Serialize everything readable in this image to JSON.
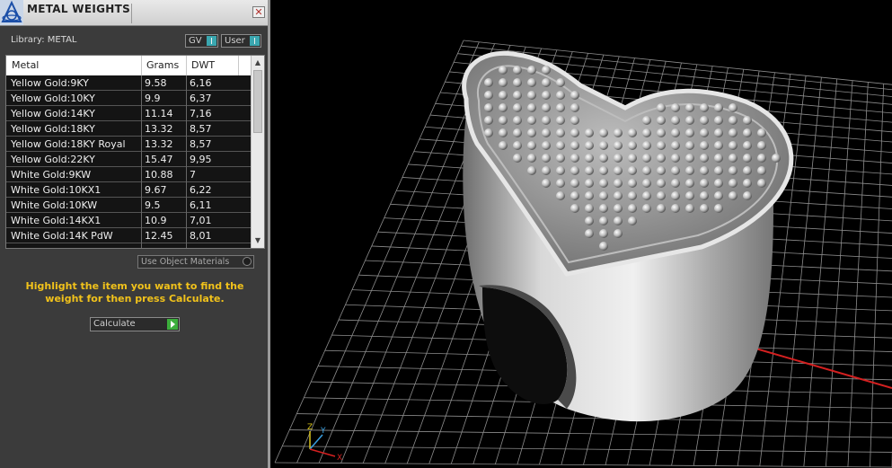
{
  "panel": {
    "title": "METAL WEIGHTS",
    "close_glyph": "✕",
    "library_label": "Library: METAL",
    "toggles": [
      {
        "label": "GV"
      },
      {
        "label": "User"
      }
    ],
    "columns": [
      "Metal",
      "Grams",
      "DWT"
    ],
    "rows": [
      {
        "metal": "Yellow Gold:9KY",
        "grams": "9.58",
        "dwt": "6,16"
      },
      {
        "metal": "Yellow Gold:10KY",
        "grams": "9.9",
        "dwt": "6,37"
      },
      {
        "metal": "Yellow Gold:14KY",
        "grams": "11.14",
        "dwt": "7,16"
      },
      {
        "metal": "Yellow Gold:18KY",
        "grams": "13.32",
        "dwt": "8,57"
      },
      {
        "metal": "Yellow Gold:18KY Royal",
        "grams": "13.32",
        "dwt": "8,57"
      },
      {
        "metal": "Yellow Gold:22KY",
        "grams": "15.47",
        "dwt": "9,95"
      },
      {
        "metal": "White Gold:9KW",
        "grams": "10.88",
        "dwt": "7"
      },
      {
        "metal": "White Gold:10KX1",
        "grams": "9.67",
        "dwt": "6,22"
      },
      {
        "metal": "White Gold:10KW",
        "grams": "9.5",
        "dwt": "6,11"
      },
      {
        "metal": "White Gold:14KX1",
        "grams": "10.9",
        "dwt": "7,01"
      },
      {
        "metal": "White Gold:14K PdW",
        "grams": "12.45",
        "dwt": "8,01"
      }
    ],
    "use_object_materials_label": "Use Object Materials",
    "hint": "Highlight the item you want to find the weight for then press Calculate.",
    "calculate_label": "Calculate"
  },
  "viewport": {
    "axis_labels": {
      "x": "X",
      "y": "Y",
      "z": "Z"
    },
    "axis_colors": {
      "x": "#d42020",
      "y": "#3aa0e0",
      "z": "#d8c21a"
    },
    "grid_color": "#8c8c8c",
    "background": "#000000"
  },
  "colors": {
    "hint_text": "#f1c21b",
    "panel_bg": "#3b3b3b",
    "row_bg": "#141414",
    "toggle_accent": "#3aa7b0",
    "calculate_accent": "#3cae3c"
  }
}
